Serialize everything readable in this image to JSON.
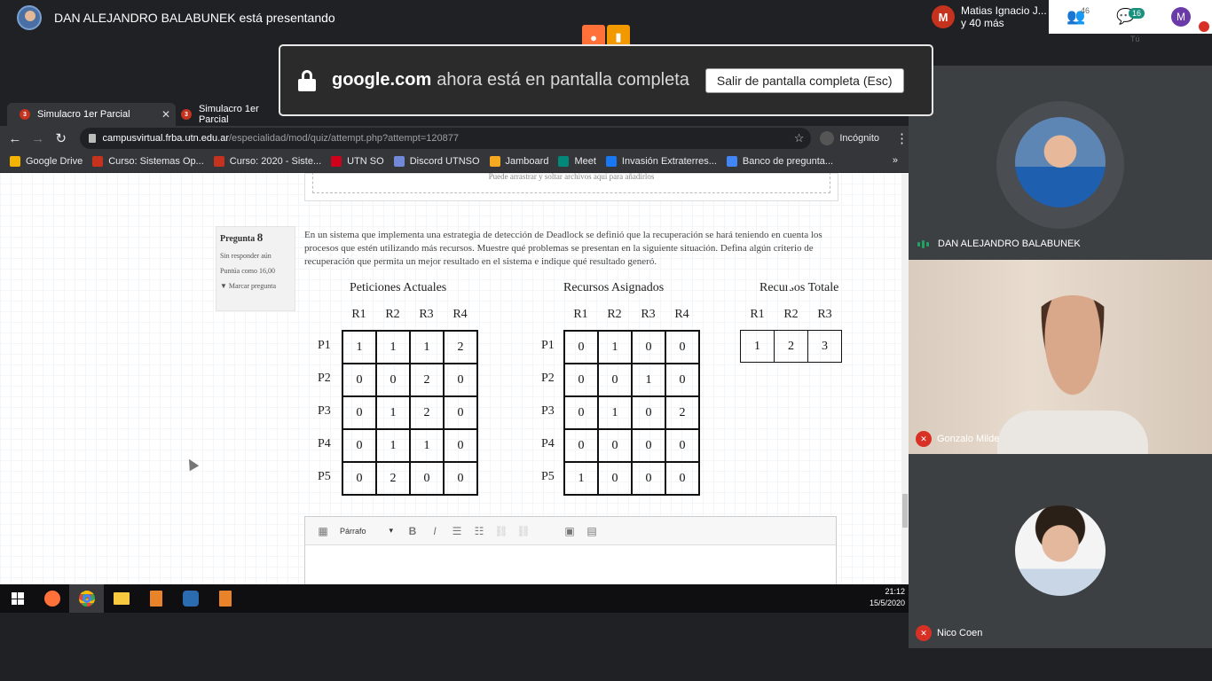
{
  "presenter": {
    "banner": "DAN ALEJANDRO BALABUNEK está presentando"
  },
  "meet": {
    "participants_badge": "M",
    "participants_line1": "Matias Ignacio J...",
    "participants_line2": "y 40 más",
    "people_count": "46",
    "chat_count": "16",
    "self_initial": "M",
    "self_label": "Tú"
  },
  "fullscreen": {
    "domain": "google.com",
    "message": "ahora está en pantalla completa",
    "exit_button": "Salir de pantalla completa (Esc)"
  },
  "browser": {
    "tabs": [
      {
        "label": "Simulacro 1er Parcial",
        "close": "✕"
      },
      {
        "label": "Simulacro 1er Parcial"
      }
    ],
    "url_host": "campusvirtual.frba.utn.edu.ar",
    "url_path": "/especialidad/mod/quiz/attempt.php?attempt=120877",
    "incognito_label": "Incógnito",
    "bookmarks": [
      {
        "label": "Google Drive",
        "color": "#f4b400"
      },
      {
        "label": "Curso: Sistemas Op...",
        "color": "#c5321d"
      },
      {
        "label": "Curso: 2020 - Siste...",
        "color": "#c5321d"
      },
      {
        "label": "UTN SO",
        "color": "#d0021b"
      },
      {
        "label": "Discord UTNSO",
        "color": "#7289da"
      },
      {
        "label": "Jamboard",
        "color": "#f6a821"
      },
      {
        "label": "Meet",
        "color": "#00897b"
      },
      {
        "label": "Invasión Extraterres...",
        "color": "#1877f2"
      },
      {
        "label": "Banco de pregunta...",
        "color": "#4285f4"
      }
    ],
    "bookmarks_more": "»"
  },
  "quiz": {
    "dropzone_text": "Puede arrastrar y soltar archivos aquí para añadirlos",
    "question_label": "Pregunta",
    "question_number": "8",
    "status": "Sin responder aún",
    "score": "Puntúa como 16,00",
    "flag": "Marcar pregunta",
    "text": "En un sistema que implementa una estrategia de detección de Deadlock se definió que la recuperación se hará teniendo en cuenta los procesos que estén utilizando más recursos. Muestre qué problemas se presentan en la siguiente situación. Defina algún criterio de recuperación que permita un mejor resultado en el sistema e indique qué resultado generó.",
    "peticiones_title": "Peticiones Actuales",
    "asignados_title": "Recursos Asignados",
    "totales_title": "Recursos Totale",
    "resources": [
      "R1",
      "R2",
      "R3",
      "R4"
    ],
    "processes": [
      "P1",
      "P2",
      "P3",
      "P4",
      "P5"
    ],
    "peticiones": [
      [
        "1",
        "1",
        "1",
        "2"
      ],
      [
        "0",
        "0",
        "2",
        "0"
      ],
      [
        "0",
        "1",
        "2",
        "0"
      ],
      [
        "0",
        "1",
        "1",
        "0"
      ],
      [
        "0",
        "2",
        "0",
        "0"
      ]
    ],
    "asignados": [
      [
        "0",
        "1",
        "0",
        "0"
      ],
      [
        "0",
        "0",
        "1",
        "0"
      ],
      [
        "0",
        "1",
        "0",
        "2"
      ],
      [
        "0",
        "0",
        "0",
        "0"
      ],
      [
        "1",
        "0",
        "0",
        "0"
      ]
    ],
    "totales": [
      "1",
      "2",
      "3"
    ],
    "editor_format": "Párrafo"
  },
  "taskbar": {
    "time": "21:12",
    "date": "15/5/2020"
  },
  "tiles": {
    "presenter_name": "DAN ALEJANDRO BALABUNEK",
    "gonzalo_name": "Gonzalo Milde",
    "nico_name": "Nico Coen"
  }
}
